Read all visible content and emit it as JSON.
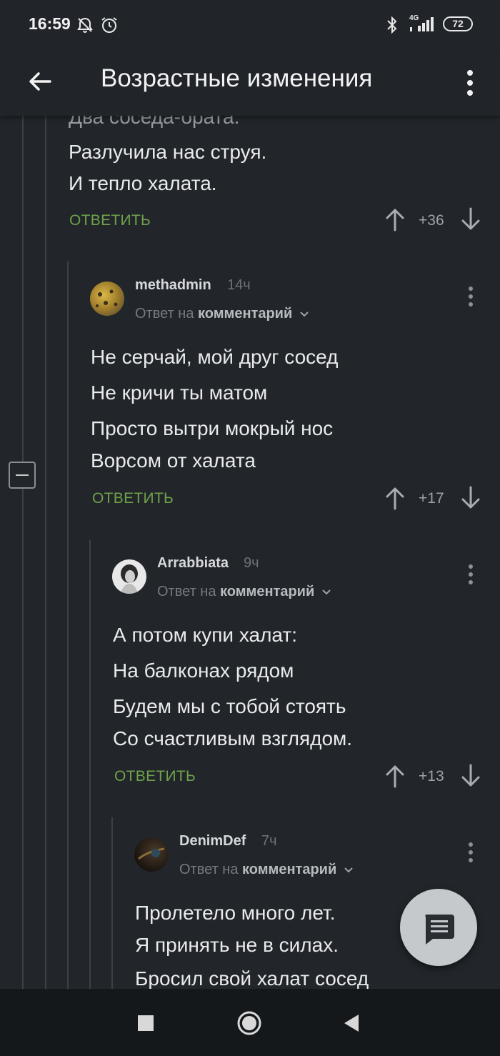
{
  "status": {
    "time": "16:59",
    "battery": "72",
    "network": "4G"
  },
  "appbar": {
    "title": "Возрастные изменения"
  },
  "top_comment": {
    "partial_line": "Два соседа-брата.",
    "lines": [
      "Разлучила нас струя.",
      "И тепло халата."
    ],
    "reply_label": "ОТВЕТИТЬ",
    "score": "+36"
  },
  "comments": [
    {
      "user": "methadmin",
      "time": "14ч",
      "reply_prefix": "Ответ на",
      "reply_target": "комментарий",
      "lines": [
        "Не серчай, мой друг сосед",
        "Не кричи ты матом",
        "Просто вытри мокрый нос",
        "Ворсом от халата"
      ],
      "reply_label": "ОТВЕТИТЬ",
      "score": "+17"
    },
    {
      "user": "Arrabbiata",
      "time": "9ч",
      "reply_prefix": "Ответ на",
      "reply_target": "комментарий",
      "lines": [
        "А потом купи халат:",
        "На балконах рядом",
        "Будем мы с тобой стоять",
        "Со счастливым взглядом."
      ],
      "reply_label": "ОТВЕТИТЬ",
      "score": "+13"
    },
    {
      "user": "DenimDef",
      "time": "7ч",
      "reply_prefix": "Ответ на",
      "reply_target": "комментарий",
      "lines": [
        "Пролетело много лет.",
        "Я принять не в силах.",
        "Бросил свой халат сосед"
      ]
    }
  ],
  "colors": {
    "background": "#22262b",
    "accent_reply": "#6fa14a",
    "fab": "#c6c9cc"
  }
}
